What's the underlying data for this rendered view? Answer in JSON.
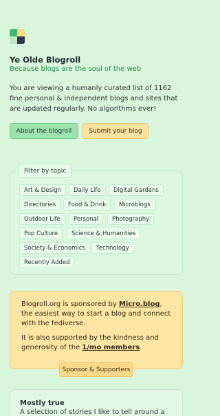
{
  "header": {
    "title": "Ye Olde Blogroll",
    "tagline": "Because blogs are the soul of the web",
    "intro": "You are viewing a humanly curated list of 1162 fine personal & independent blogs and sites that are updated regularly. No algorithms ever!"
  },
  "buttons": {
    "about": "About the blogroll",
    "submit": "Submit your blog"
  },
  "topics": {
    "legend": "Filter by topic",
    "items": [
      "Art & Design",
      "Daily Life",
      "Digital Gardens",
      "Directories",
      "Food & Drink",
      "Microblogs",
      "Outdoor Life",
      "Personal",
      "Photography",
      "Pop Culture",
      "Science & Humanities",
      "Society & Economics",
      "Technology",
      "Recently Added"
    ]
  },
  "sponsor": {
    "p1_before": "Blogroll.org is sponsored by ",
    "p1_link": "Micro.blog",
    "p1_after": ", the easiest way to start a blog and connect with the fediverse.",
    "p2_before": "It is also supported by the kindness and generosity of the ",
    "p2_link": "1/mo members",
    "p2_after": ".",
    "button": "Sponsor & Supporters"
  },
  "story": {
    "title": "Mostly true",
    "text": "A selection of stories I like to tell around a"
  },
  "colors": {
    "background": "#d9f5dc",
    "accent_green": "#1f8a45",
    "button_green": "#9ee2ad",
    "button_yellow": "#fde3a1"
  }
}
